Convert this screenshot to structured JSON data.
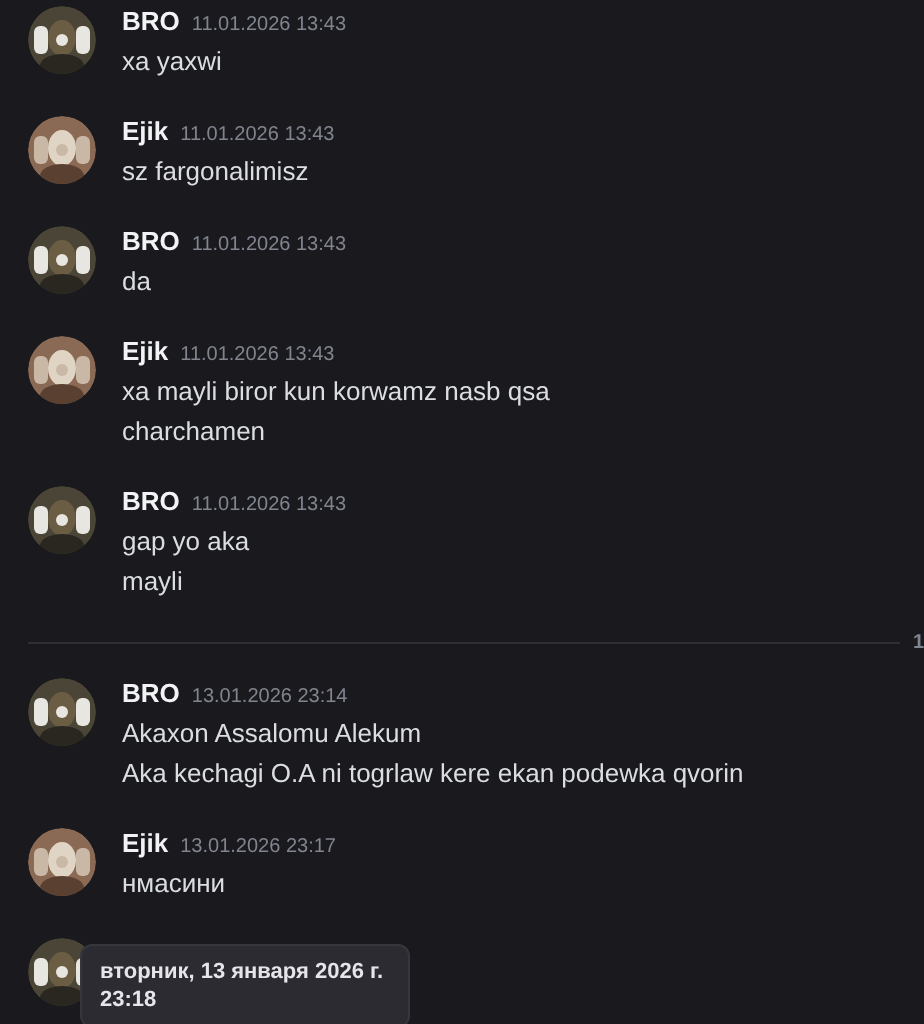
{
  "messages": [
    {
      "kind": "dark",
      "author": "BRO",
      "time": "11.01.2026 13:43",
      "lines": [
        "xa yaxwi"
      ]
    },
    {
      "kind": "warm",
      "author": "Ejik",
      "time": "11.01.2026 13:43",
      "lines": [
        "sz fargonalimisz"
      ]
    },
    {
      "kind": "dark",
      "author": "BRO",
      "time": "11.01.2026 13:43",
      "lines": [
        "da"
      ]
    },
    {
      "kind": "warm",
      "author": "Ejik",
      "time": "11.01.2026 13:43",
      "lines": [
        "xa mayli biror kun korwamz nasb qsa",
        "charchamen"
      ]
    },
    {
      "kind": "dark",
      "author": "BRO",
      "time": "11.01.2026 13:43",
      "lines": [
        "gap yo aka",
        "mayli"
      ]
    },
    {
      "kind": "divider",
      "label": "1"
    },
    {
      "kind": "dark",
      "author": "BRO",
      "time": "13.01.2026 23:14",
      "lines": [
        "Akaxon Assalomu Alekum",
        "Aka kechagi O.A ni togrlaw kere ekan podewka qvorin"
      ]
    },
    {
      "kind": "warm",
      "author": "Ejik",
      "time": "13.01.2026 23:17",
      "lines": [
        "нмасини"
      ]
    },
    {
      "kind": "dark"
    }
  ],
  "tooltip": {
    "lines": [
      "вторник, 13 января 2026 г.",
      "23:18"
    ]
  }
}
